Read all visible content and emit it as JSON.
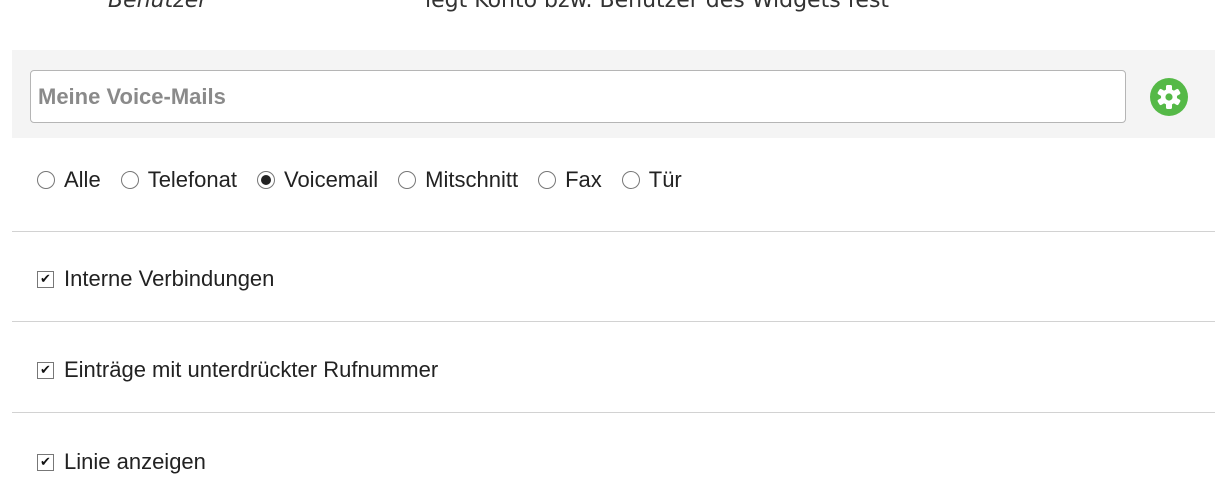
{
  "cutoff_header": {
    "left_text": "Benutzer",
    "right_text": "legt Konto bzw. Benutzer des Widgets fest"
  },
  "widget": {
    "title_value": "Meine Voice-Mails",
    "settings_icon": "gear-icon",
    "accent_color": "#55b947"
  },
  "filter": {
    "options": [
      "Alle",
      "Telefonat",
      "Voicemail",
      "Mitschnitt",
      "Fax",
      "Tür"
    ],
    "selected": "Voicemail"
  },
  "checkboxes": [
    {
      "label": "Interne Verbindungen",
      "checked": true
    },
    {
      "label": "Einträge mit unterdrückter Rufnummer",
      "checked": true
    },
    {
      "label": "Linie anzeigen",
      "checked": true
    }
  ]
}
